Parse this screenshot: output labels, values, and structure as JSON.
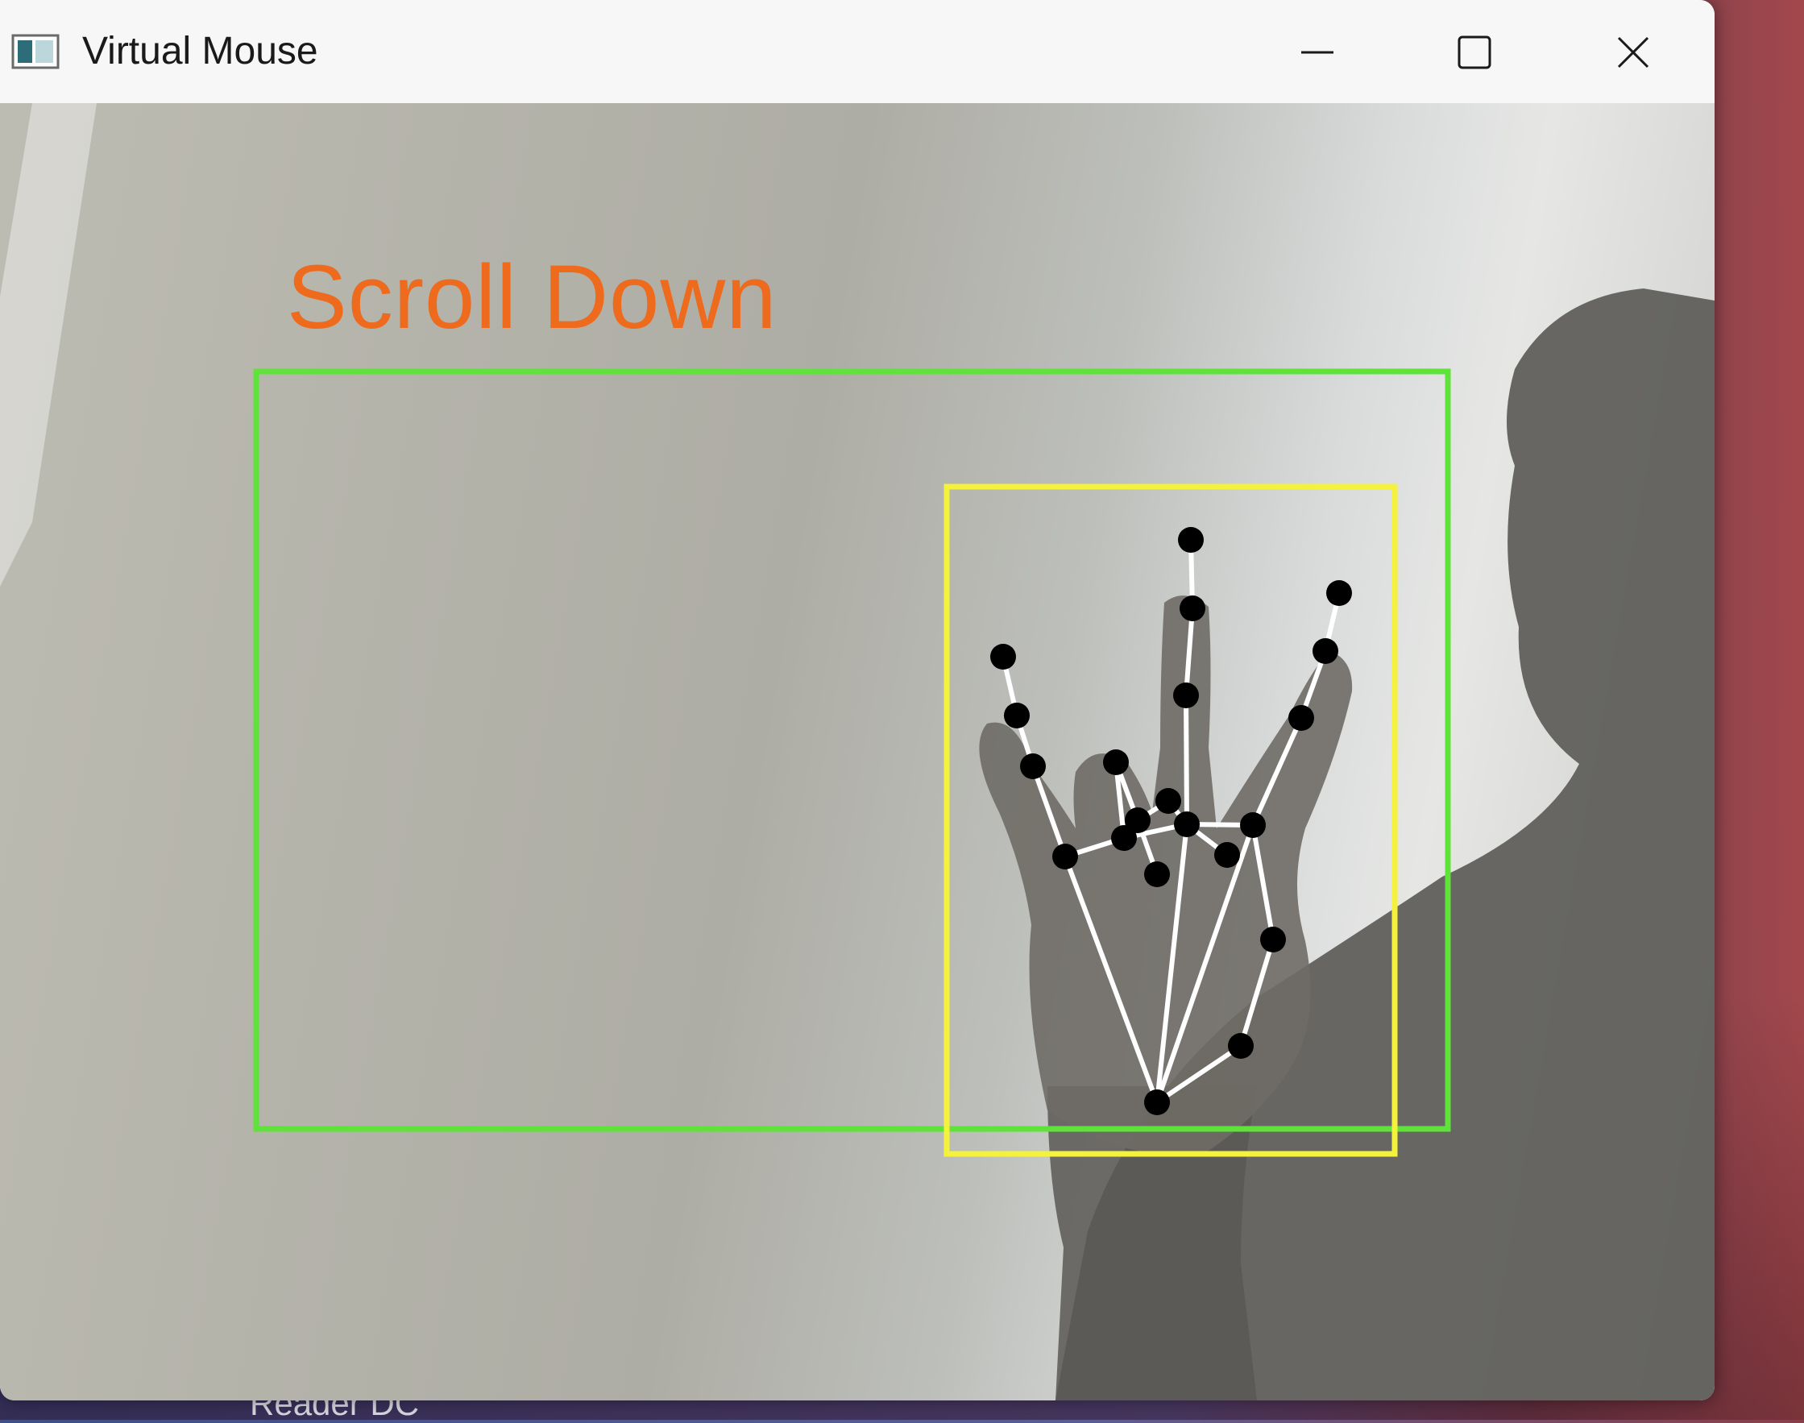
{
  "window": {
    "title": "Virtual Mouse",
    "controls": [
      "minimize-icon",
      "maximize-icon",
      "close-icon"
    ]
  },
  "camera": {
    "gesture_label": "Scroll Down",
    "colors": {
      "gesture_label": "#ee6a1c",
      "active_region_box": "#5fe23a",
      "hand_bounding_box": "#f4f23a",
      "landmark_points": "#000000",
      "landmark_connections": "#ffffff"
    }
  },
  "background": {
    "taskbar_text": "Reader DC"
  }
}
